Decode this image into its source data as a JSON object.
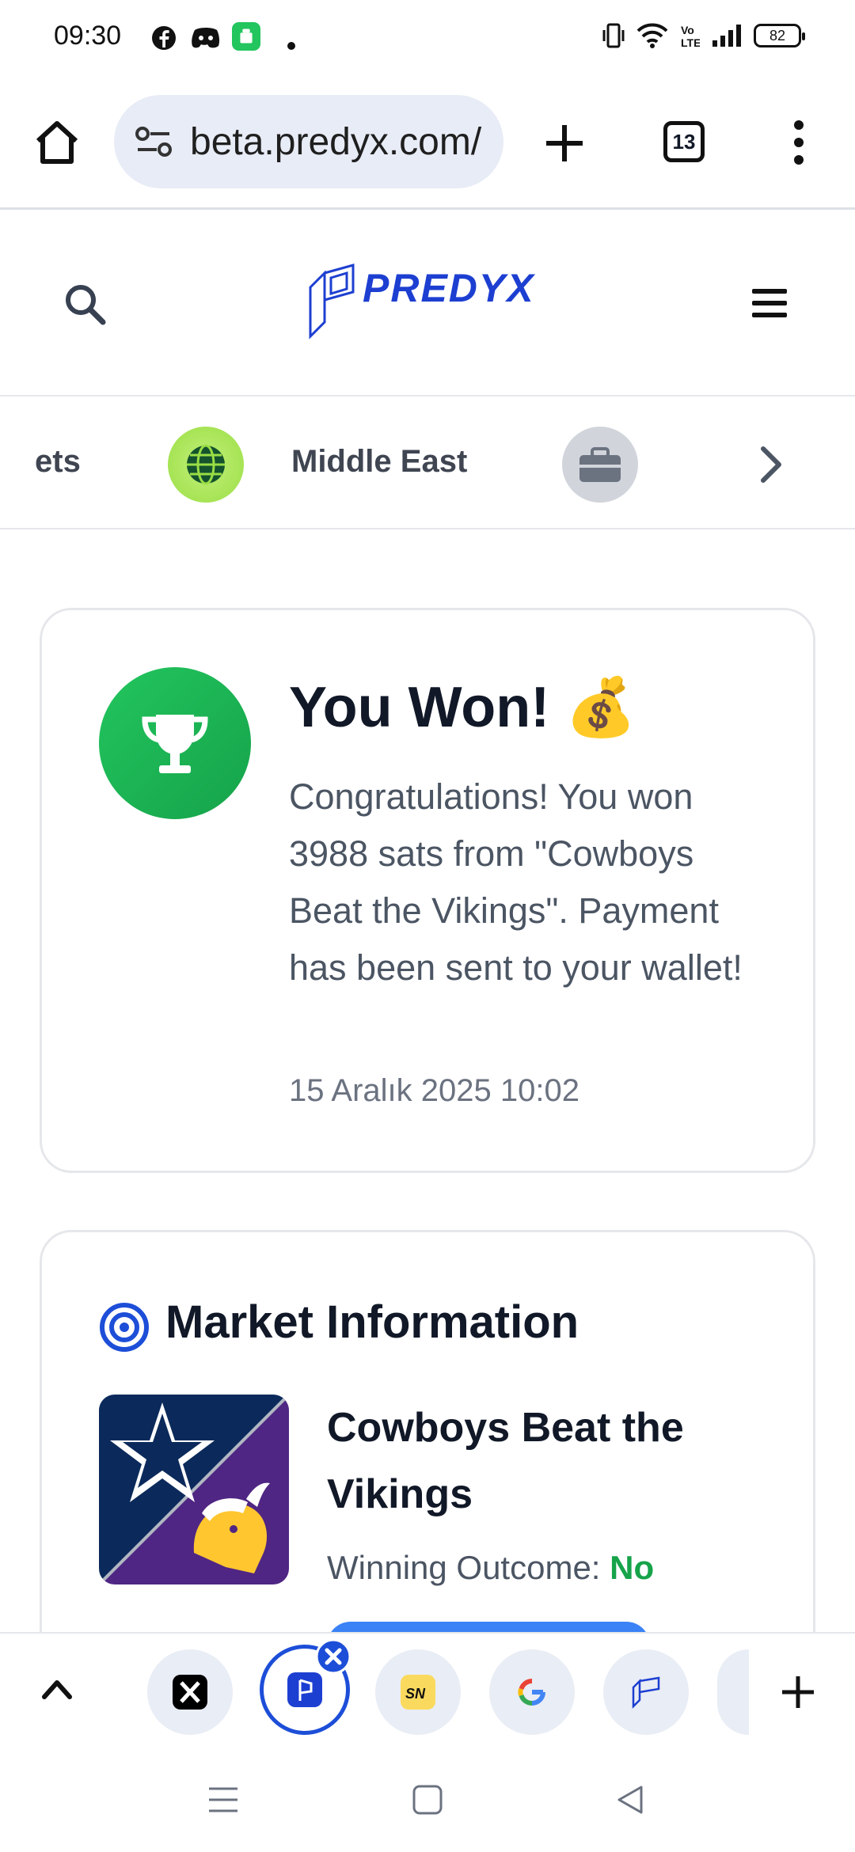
{
  "status_bar": {
    "time": "09:30",
    "battery": "82",
    "notification_icons": [
      "facebook-icon",
      "discord-icon",
      "android-app-icon",
      "dot-icon"
    ],
    "system_icons": [
      "vibrate-icon",
      "wifi-icon",
      "volte-icon",
      "signal-icon",
      "battery-icon"
    ]
  },
  "browser": {
    "url": "beta.predyx.com/",
    "tab_count": "13"
  },
  "site": {
    "logo_text": "PREDYX"
  },
  "categories": {
    "items": [
      {
        "label": "ets"
      },
      {
        "label": "Middle East"
      }
    ]
  },
  "won_card": {
    "title": "You Won! 💰",
    "message": "Congratulations! You won 3988 sats from \"Cowboys Beat the Vikings\". Payment has been sent to your wallet!",
    "date": "15 Aralık 2025 10:02"
  },
  "market_info": {
    "title": "Market Information",
    "market_name": "Cowboys Beat the Vikings",
    "outcome_label": "Winning Outcome:",
    "outcome_value": "No"
  },
  "colors": {
    "brand": "#1d3fd1",
    "success": "#16a34a",
    "accent": "#3b82f6"
  }
}
